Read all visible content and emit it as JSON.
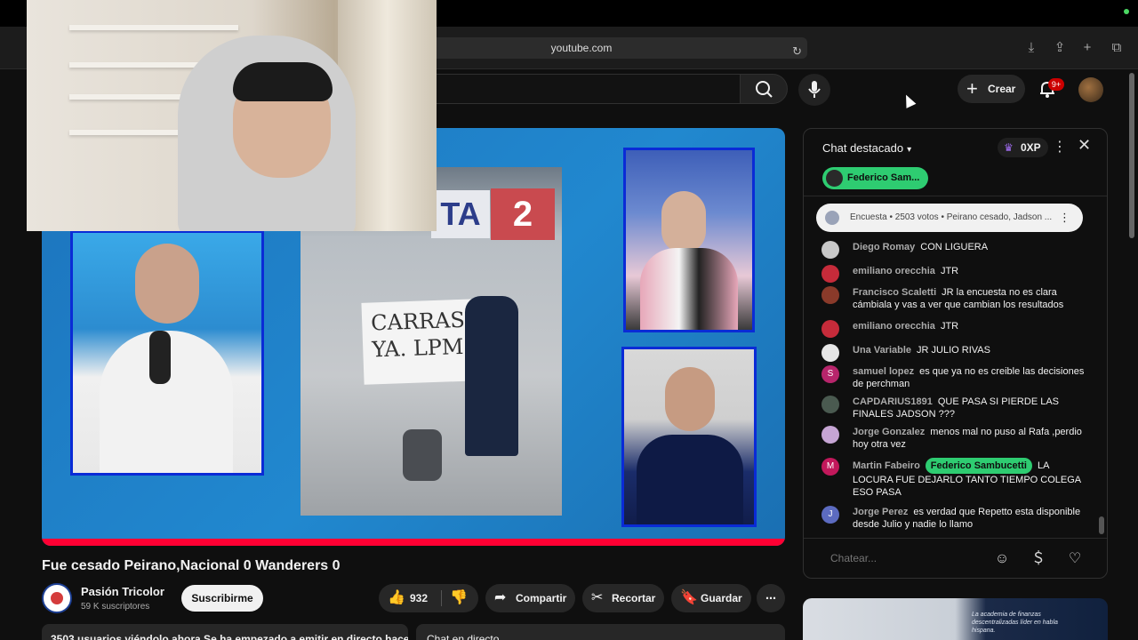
{
  "browser": {
    "url": "youtube.com"
  },
  "header": {
    "create_label": "Crear",
    "notif_count": "9+"
  },
  "video": {
    "title": "Fue cesado Peirano,Nacional 0 Wanderers 0",
    "scoreboard_digit": "2",
    "scoreboard_letters": "TA",
    "banner_text": "CARRAS YA. LPM"
  },
  "channel": {
    "name": "Pasión Tricolor",
    "subscribers": "59 K suscriptores",
    "subscribe_label": "Suscribirme"
  },
  "actions": {
    "likes": "932",
    "share": "Compartir",
    "clip": "Recortar",
    "save": "Guardar"
  },
  "description": {
    "teaser": "3503 usuarios viéndolo ahora  Se ha empezado a emitir en directo hace",
    "chat_replay": "Chat en directo"
  },
  "chat": {
    "title": "Chat destacado",
    "xp": "0XP",
    "pinned_donor": "Federico Sam...",
    "poll": "Encuesta • 2503 votos • Peirano cesado, Jadson ...",
    "input_placeholder": "Chatear...",
    "messages": [
      {
        "author": "Diego Romay",
        "text": "CON LIGUERA",
        "color": "#c8c8c8",
        "initial": ""
      },
      {
        "author": "emiliano orecchia",
        "text": "JTR",
        "color": "#c62b3a",
        "initial": ""
      },
      {
        "author": "Francisco Scaletti",
        "text": "JR la encuesta no es clara cámbiala y vas a ver que cambian los resultados",
        "color": "#8a3a2a",
        "initial": ""
      },
      {
        "author": "emiliano orecchia",
        "text": "JTR",
        "color": "#c62b3a",
        "initial": ""
      },
      {
        "author": "Una Variable",
        "text": "JR JULIO RIVAS",
        "color": "#e6e6e6",
        "initial": ""
      },
      {
        "author": "samuel lopez",
        "text": "es que ya no es creible las decisiones de perchman",
        "color": "#b7256b",
        "initial": "S"
      },
      {
        "author": "CAPDARIUS1891",
        "text": "QUE PASA SI PIERDE LAS FINALES JADSON ???",
        "color": "#4a5a50",
        "initial": ""
      },
      {
        "author": "Jorge Gonzalez",
        "text": "menos mal no puso al Rafa ,perdio hoy otra vez",
        "color": "#c6a5d4",
        "initial": ""
      },
      {
        "author": "Martin Fabeiro",
        "badge": "Federico Sambucetti",
        "text": "LA LOCURA FUE DEJARLO TANTO TIEMPO COLEGA ESO PASA",
        "color": "#c2185b",
        "initial": "M"
      },
      {
        "author": "Jorge Perez",
        "text": "es verdad que Repetto esta disponible desde Julio y nadie lo llamo",
        "color": "#5c6bc0",
        "initial": "J"
      }
    ]
  },
  "ad": {
    "text": "La academia de finanzas descentralizadas líder en habla hispana."
  }
}
